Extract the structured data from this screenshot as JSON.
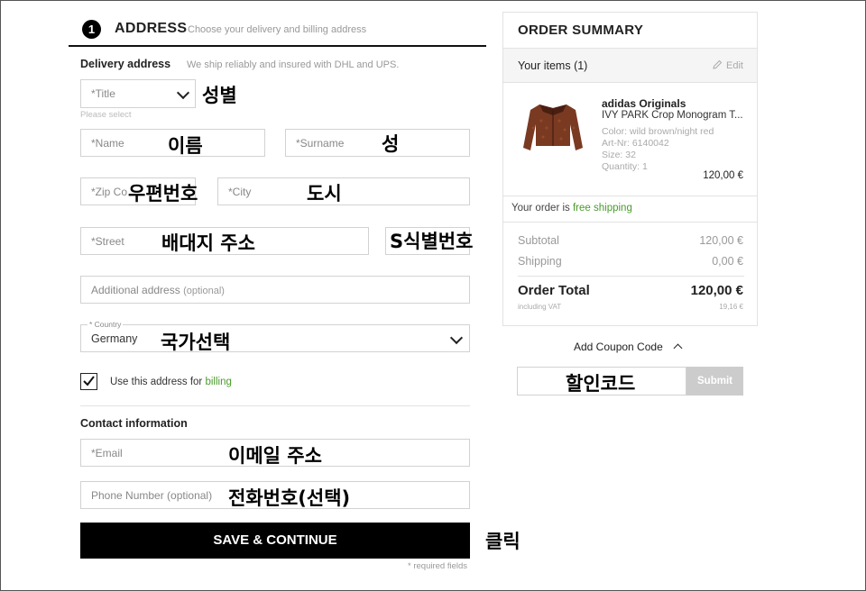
{
  "step": {
    "number": "1",
    "title": "ADDRESS",
    "subtitle": "Choose your delivery and billing address"
  },
  "delivery": {
    "title": "Delivery address",
    "note": "We ship reliably and insured with DHL and UPS."
  },
  "form": {
    "title_select": {
      "placeholder": "*Title",
      "hint": "Please select"
    },
    "name": "*Name",
    "surname": "*Surname",
    "zip": "*Zip Co",
    "city": "*City",
    "street": "*Street",
    "additional": {
      "label": "Additional address",
      "optional": "(optional)"
    },
    "country": {
      "label": "* Country",
      "value": "Germany"
    },
    "billing_checkbox": {
      "label": "Use this address for",
      "highlight": "billing",
      "checked": true
    }
  },
  "contact": {
    "title": "Contact information",
    "email": "*Email",
    "phone": "Phone Number (optional)"
  },
  "save_button": "SAVE & CONTINUE",
  "required_note": "* required fields",
  "annotations": {
    "title": "성별",
    "name": "이름",
    "surname": "성",
    "zip": "우편번호",
    "city": "도시",
    "street": "배대지 주소",
    "street_id": "S식별번호",
    "country": "국가선택",
    "email": "이메일 주소",
    "phone": "전화번호(선택)",
    "click": "클릭",
    "coupon": "할인코드"
  },
  "summary": {
    "title": "ORDER SUMMARY",
    "items_label": "Your items (1)",
    "edit": "Edit",
    "product": {
      "brand": "adidas Originals",
      "name": "IVY PARK Crop Monogram T...",
      "color": "Color: wild brown/night red",
      "art": "Art-Nr: 6140042",
      "size": "Size: 32",
      "quantity": "Quantity: 1",
      "price": "120,00 €"
    },
    "shipping_note": {
      "prefix": "Your order is",
      "highlight": "free shipping"
    },
    "subtotal": {
      "label": "Subtotal",
      "value": "120,00 €"
    },
    "shipping": {
      "label": "Shipping",
      "value": "0,00 €"
    },
    "total": {
      "label": "Order Total",
      "value": "120,00 €"
    },
    "vat": {
      "label": "including VAT",
      "value": "19,16 €"
    }
  },
  "coupon": {
    "label": "Add Coupon Code",
    "submit": "Submit"
  },
  "colors": {
    "accent_green": "#4a9b2c",
    "button_black": "#000000",
    "submit_gray": "#cccccc"
  }
}
